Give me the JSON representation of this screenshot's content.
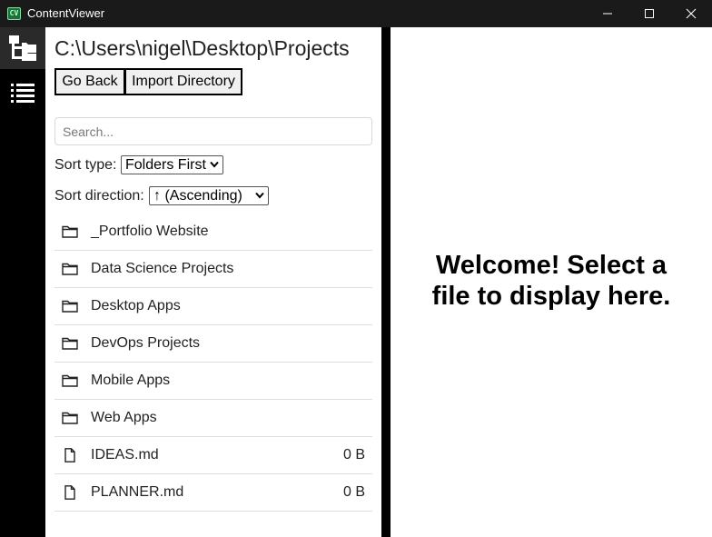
{
  "window": {
    "app_icon_text": "CV",
    "title": "ContentViewer",
    "controls": [
      "minimize-icon",
      "maximize-icon",
      "close-icon"
    ]
  },
  "sidebar": {
    "buttons": [
      {
        "icon": "tree-view-icon",
        "active": true
      },
      {
        "icon": "list-view-icon",
        "active": false
      }
    ]
  },
  "explorer": {
    "path": "C:\\Users\\nigel\\Desktop\\Projects",
    "go_back_label": "Go Back",
    "import_label": "Import Directory",
    "search_placeholder": "Search...",
    "sort_type_label": "Sort type:",
    "sort_type_value": "Folders First",
    "sort_direction_label": "Sort direction:",
    "sort_direction_value": "↑ (Ascending)",
    "items": [
      {
        "type": "folder",
        "name": "_Portfolio Website",
        "size": ""
      },
      {
        "type": "folder",
        "name": "Data Science Projects",
        "size": ""
      },
      {
        "type": "folder",
        "name": "Desktop Apps",
        "size": ""
      },
      {
        "type": "folder",
        "name": "DevOps Projects",
        "size": ""
      },
      {
        "type": "folder",
        "name": "Mobile Apps",
        "size": ""
      },
      {
        "type": "folder",
        "name": "Web Apps",
        "size": ""
      },
      {
        "type": "file",
        "name": "IDEAS.md",
        "size": "0 B"
      },
      {
        "type": "file",
        "name": "PLANNER.md",
        "size": "0 B"
      }
    ]
  },
  "viewer": {
    "welcome_line1": "Welcome! Select a",
    "welcome_line2": "file to display here."
  },
  "colors": {
    "titlebar": "#1a1a1a",
    "sidebar": "#000000",
    "active_sidebar_button": "#2a2a2a",
    "app_icon": "#1f6f3f"
  }
}
